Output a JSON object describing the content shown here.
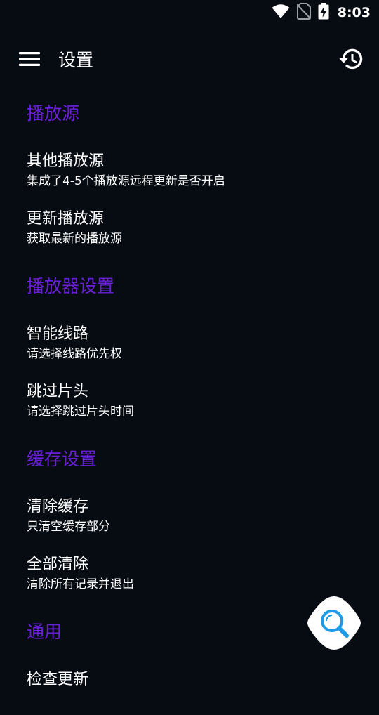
{
  "status_bar": {
    "time": "8:03",
    "icons": [
      "wifi-icon",
      "no-sim-icon",
      "battery-charging-icon"
    ]
  },
  "toolbar": {
    "title": "设置",
    "menu_icon": "menu-icon",
    "history_icon": "history-icon"
  },
  "settings": {
    "categories": [
      {
        "title": "播放源",
        "items": [
          {
            "title": "其他播放源",
            "summary": "集成了4-5个播放源远程更新是否开启"
          },
          {
            "title": "更新播放源",
            "summary": "获取最新的播放源"
          }
        ]
      },
      {
        "title": "播放器设置",
        "items": [
          {
            "title": "智能线路",
            "summary": "请选择线路优先权"
          },
          {
            "title": "跳过片头",
            "summary": "请选择跳过片头时间"
          }
        ]
      },
      {
        "title": "缓存设置",
        "items": [
          {
            "title": "清除缓存",
            "summary": "只清空缓存部分"
          },
          {
            "title": "全部清除",
            "summary": "清除所有记录并退出"
          }
        ]
      },
      {
        "title": "通用",
        "items": [
          {
            "title": "检查更新",
            "summary": ""
          }
        ]
      }
    ]
  },
  "fab": {
    "icon": "search-icon"
  },
  "colors": {
    "background": "#070b12",
    "accent": "#6a1fd8",
    "fab_icon": "#1e9be6",
    "text": "#ffffff"
  }
}
